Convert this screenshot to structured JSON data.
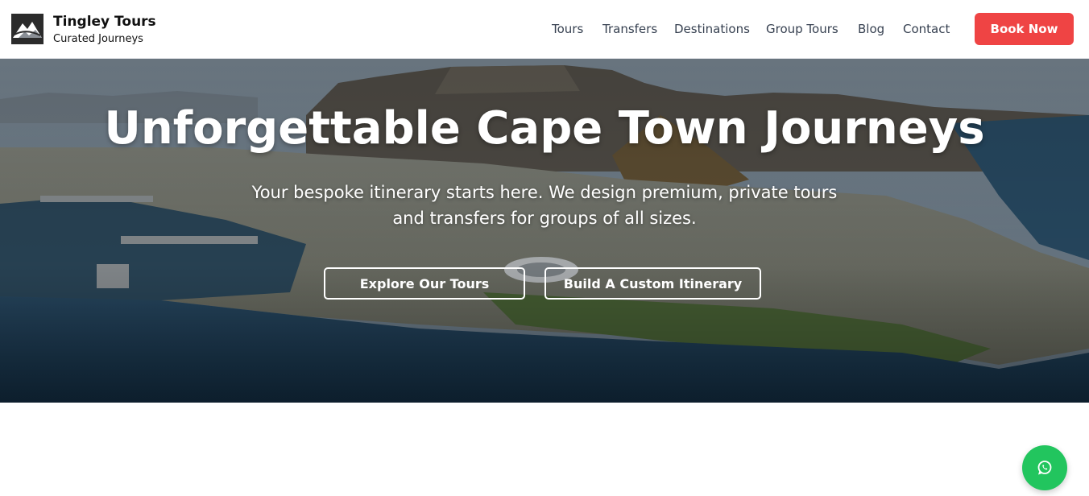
{
  "brand": {
    "name": "Tingley Tours",
    "tagline": "Curated Journeys",
    "logo_icon": "mountain-logo-icon"
  },
  "nav": {
    "items": [
      {
        "label": "Tours"
      },
      {
        "label": "Transfers"
      },
      {
        "label": "Destinations"
      },
      {
        "label": "Group Tours"
      },
      {
        "label": "Blog"
      },
      {
        "label": "Contact"
      }
    ],
    "cta_label": "Book Now"
  },
  "hero": {
    "title": "Unforgettable Cape Town Journeys",
    "subtitle": "Your bespoke itinerary starts here. We design premium, private tours and transfers for groups of all sizes.",
    "primary_button": "Explore Our Tours",
    "secondary_button": "Build A Custom Itinerary"
  },
  "floating": {
    "whatsapp_icon": "whatsapp-icon"
  },
  "colors": {
    "accent": "#ef4444",
    "whatsapp": "#22c55e",
    "nav_text": "#374151"
  }
}
